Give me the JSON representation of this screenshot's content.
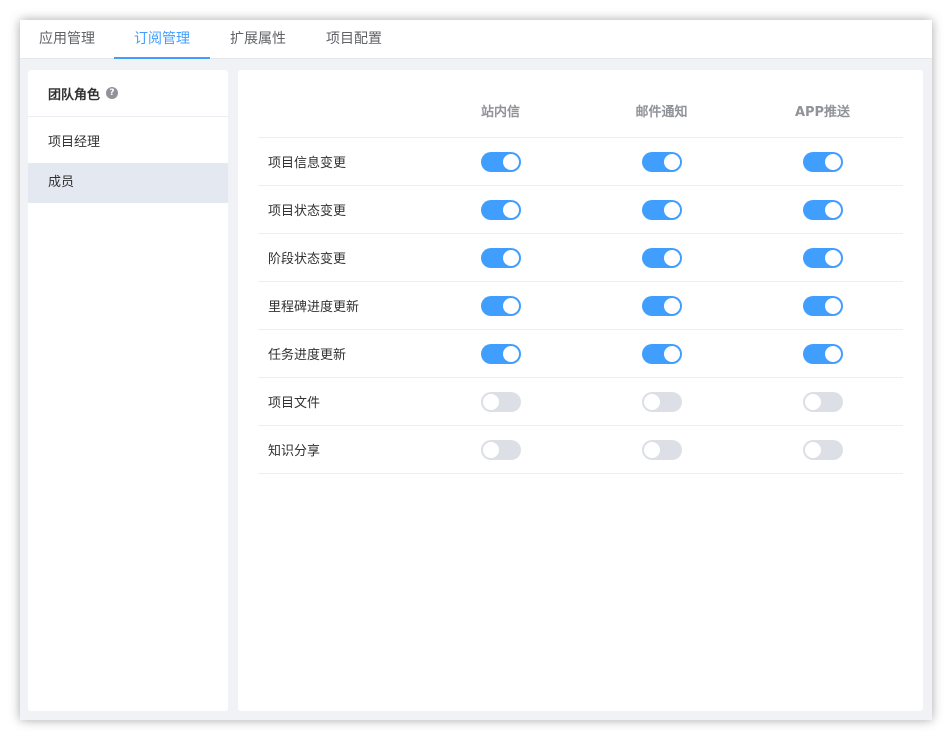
{
  "tabs": [
    {
      "label": "应用管理"
    },
    {
      "label": "订阅管理",
      "active": true
    },
    {
      "label": "扩展属性"
    },
    {
      "label": "项目配置"
    }
  ],
  "sidebar": {
    "title": "团队角色",
    "help_icon": "question-circle-icon",
    "items": [
      {
        "label": "项目经理"
      },
      {
        "label": "成员",
        "selected": true
      }
    ]
  },
  "table": {
    "columns": [
      "",
      "站内信",
      "邮件通知",
      "APP推送"
    ],
    "rows": [
      {
        "name": "项目信息变更",
        "channels": [
          true,
          true,
          true
        ]
      },
      {
        "name": "项目状态变更",
        "channels": [
          true,
          true,
          true
        ]
      },
      {
        "name": "阶段状态变更",
        "channels": [
          true,
          true,
          true
        ]
      },
      {
        "name": "里程碑进度更新",
        "channels": [
          true,
          true,
          true
        ]
      },
      {
        "name": "任务进度更新",
        "channels": [
          true,
          true,
          true
        ]
      },
      {
        "name": "项目文件",
        "channels": [
          false,
          false,
          false
        ]
      },
      {
        "name": "知识分享",
        "channels": [
          false,
          false,
          false
        ]
      }
    ]
  },
  "colors": {
    "accent": "#409eff",
    "switch_off": "#dcdfe6",
    "selected_bg": "#e4e8f0"
  }
}
